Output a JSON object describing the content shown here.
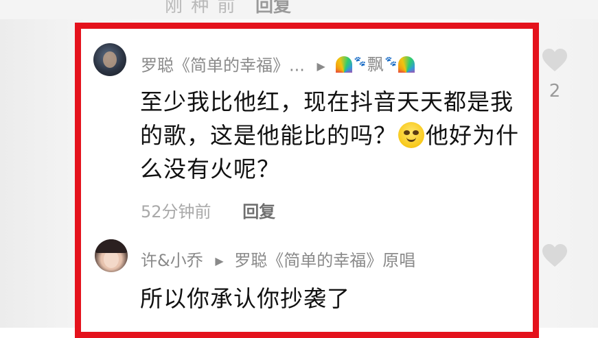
{
  "top_strip": {
    "cut_text": "刚 种 前",
    "cut_reply": "回复"
  },
  "comments": [
    {
      "user": "罗聪《简单的幸福》...",
      "reply_to": "飘",
      "text_a": "至少我比他红，现在抖音天天都是我的歌，这是他能比的吗？",
      "text_b": "他好为什么没有火呢？",
      "time": "52分钟前",
      "reply_label": "回复",
      "likes": "2"
    },
    {
      "user": "许&小乔",
      "reply_to": "罗聪《简单的幸福》原唱",
      "text": "所以你承认你抄袭了"
    }
  ],
  "colors": {
    "highlight_frame": "#e4121c",
    "text": "#111111",
    "secondary_text": "#8a8a8a"
  },
  "icons": {
    "emoji": "smiley-emoji",
    "like": "heart-icon",
    "arrow": "triangle-right-icon",
    "nick_decor": [
      "rainbow-emoji",
      "paw-emoji"
    ]
  }
}
